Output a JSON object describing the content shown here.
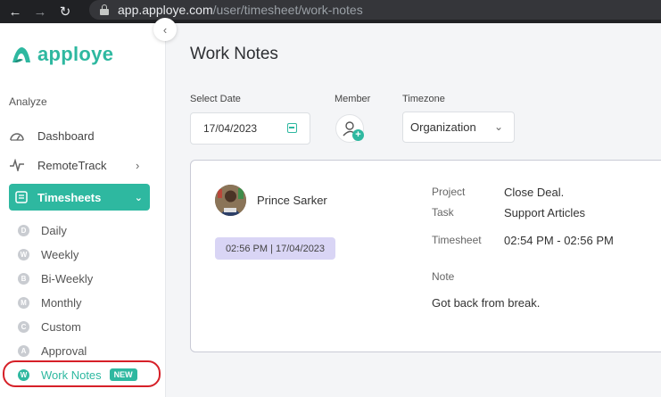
{
  "browser": {
    "url_host": "app.apploye.com",
    "url_path": "/user/timesheet/work-notes"
  },
  "sidebar": {
    "logo_text": "apploye",
    "section_label": "Analyze",
    "items": [
      {
        "label": "Dashboard",
        "icon": "gauge-icon"
      },
      {
        "label": "RemoteTrack",
        "icon": "pulse-icon"
      }
    ],
    "active_group": {
      "label": "Timesheets",
      "icon": "timesheet-icon"
    },
    "sub_items": [
      {
        "letter": "D",
        "label": "Daily"
      },
      {
        "letter": "W",
        "label": "Weekly"
      },
      {
        "letter": "B",
        "label": "Bi-Weekly"
      },
      {
        "letter": "M",
        "label": "Monthly"
      },
      {
        "letter": "C",
        "label": "Custom"
      },
      {
        "letter": "A",
        "label": "Approval"
      },
      {
        "letter": "W",
        "label": "Work Notes",
        "badge": "NEW"
      }
    ]
  },
  "colors": {
    "accent": "#2eb8a0",
    "pill": "#d9d5f5",
    "highlight_outline": "#d62028"
  },
  "main": {
    "title": "Work Notes",
    "filters": {
      "date_label": "Select Date",
      "date_value": "17/04/2023",
      "member_label": "Member",
      "timezone_label": "Timezone",
      "timezone_value": "Organization"
    },
    "note": {
      "user_name": "Prince Sarker",
      "timestamp": "02:56 PM | 17/04/2023",
      "project_label": "Project",
      "project_value": "Close Deal.",
      "task_label": "Task",
      "task_value": "Support Articles",
      "timesheet_label": "Timesheet",
      "timesheet_value": "02:54 PM - 02:56 PM",
      "note_label": "Note",
      "note_text": "Got back from break."
    }
  }
}
